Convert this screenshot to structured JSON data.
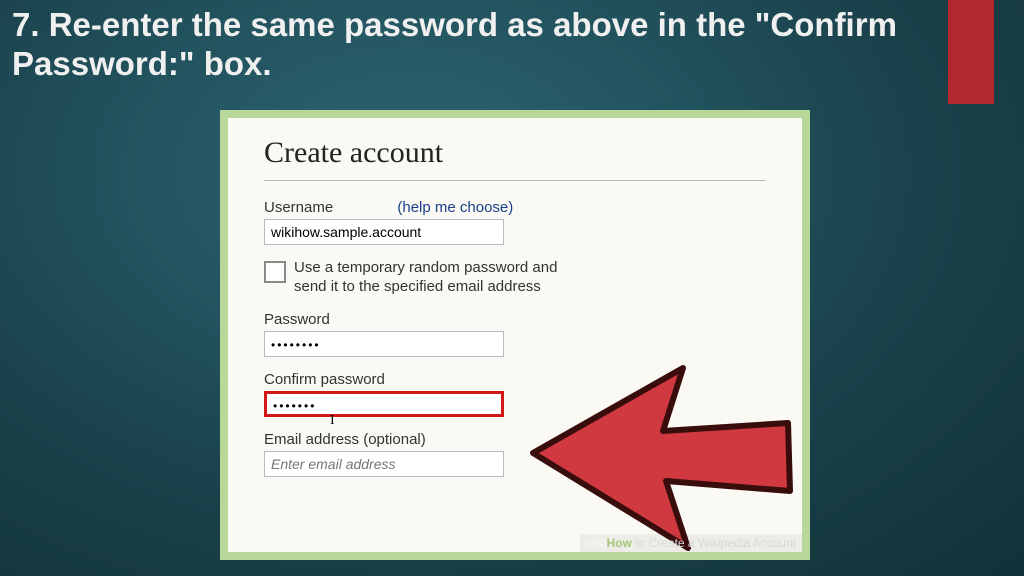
{
  "slide": {
    "number": "7.",
    "instruction": "Re-enter the same password as above in the \"Confirm Password:\" box."
  },
  "form": {
    "heading": "Create account",
    "username_label": "Username",
    "help_link": "(help me choose)",
    "username_value": "wikihow.sample.account",
    "temp_pw_label": "Use a temporary random password and send it to the specified email address",
    "password_label": "Password",
    "password_mask": "••••••••",
    "confirm_label": "Confirm password",
    "confirm_mask": "•••••••",
    "email_label": "Email address (optional)",
    "email_placeholder": "Enter email address"
  },
  "caption": {
    "wiki": "wiki",
    "how": "How",
    "rest": " to Create a Wikipedia Account"
  }
}
